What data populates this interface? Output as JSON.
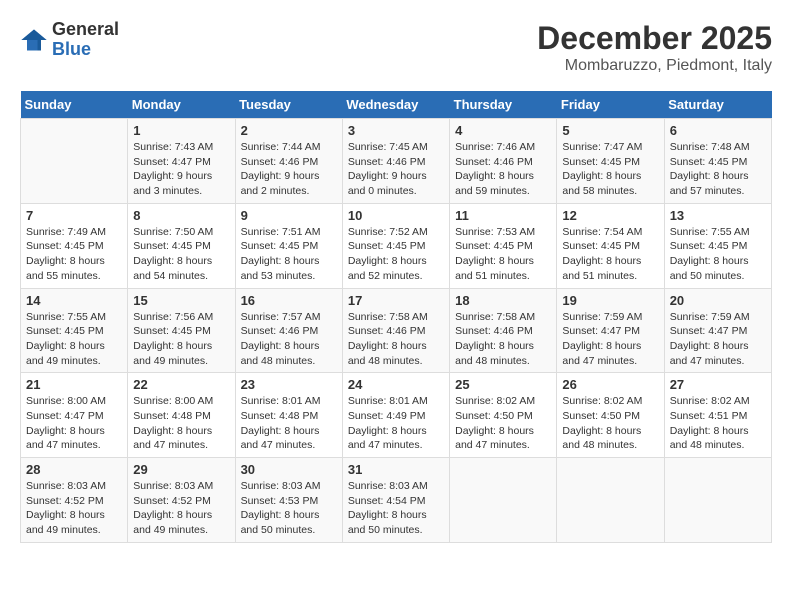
{
  "header": {
    "logo_line1": "General",
    "logo_line2": "Blue",
    "month": "December 2025",
    "location": "Mombaruzzo, Piedmont, Italy"
  },
  "days_of_week": [
    "Sunday",
    "Monday",
    "Tuesday",
    "Wednesday",
    "Thursday",
    "Friday",
    "Saturday"
  ],
  "weeks": [
    [
      {
        "day": "",
        "info": ""
      },
      {
        "day": "1",
        "info": "Sunrise: 7:43 AM\nSunset: 4:47 PM\nDaylight: 9 hours\nand 3 minutes."
      },
      {
        "day": "2",
        "info": "Sunrise: 7:44 AM\nSunset: 4:46 PM\nDaylight: 9 hours\nand 2 minutes."
      },
      {
        "day": "3",
        "info": "Sunrise: 7:45 AM\nSunset: 4:46 PM\nDaylight: 9 hours\nand 0 minutes."
      },
      {
        "day": "4",
        "info": "Sunrise: 7:46 AM\nSunset: 4:46 PM\nDaylight: 8 hours\nand 59 minutes."
      },
      {
        "day": "5",
        "info": "Sunrise: 7:47 AM\nSunset: 4:45 PM\nDaylight: 8 hours\nand 58 minutes."
      },
      {
        "day": "6",
        "info": "Sunrise: 7:48 AM\nSunset: 4:45 PM\nDaylight: 8 hours\nand 57 minutes."
      }
    ],
    [
      {
        "day": "7",
        "info": "Sunrise: 7:49 AM\nSunset: 4:45 PM\nDaylight: 8 hours\nand 55 minutes."
      },
      {
        "day": "8",
        "info": "Sunrise: 7:50 AM\nSunset: 4:45 PM\nDaylight: 8 hours\nand 54 minutes."
      },
      {
        "day": "9",
        "info": "Sunrise: 7:51 AM\nSunset: 4:45 PM\nDaylight: 8 hours\nand 53 minutes."
      },
      {
        "day": "10",
        "info": "Sunrise: 7:52 AM\nSunset: 4:45 PM\nDaylight: 8 hours\nand 52 minutes."
      },
      {
        "day": "11",
        "info": "Sunrise: 7:53 AM\nSunset: 4:45 PM\nDaylight: 8 hours\nand 51 minutes."
      },
      {
        "day": "12",
        "info": "Sunrise: 7:54 AM\nSunset: 4:45 PM\nDaylight: 8 hours\nand 51 minutes."
      },
      {
        "day": "13",
        "info": "Sunrise: 7:55 AM\nSunset: 4:45 PM\nDaylight: 8 hours\nand 50 minutes."
      }
    ],
    [
      {
        "day": "14",
        "info": "Sunrise: 7:55 AM\nSunset: 4:45 PM\nDaylight: 8 hours\nand 49 minutes."
      },
      {
        "day": "15",
        "info": "Sunrise: 7:56 AM\nSunset: 4:45 PM\nDaylight: 8 hours\nand 49 minutes."
      },
      {
        "day": "16",
        "info": "Sunrise: 7:57 AM\nSunset: 4:46 PM\nDaylight: 8 hours\nand 48 minutes."
      },
      {
        "day": "17",
        "info": "Sunrise: 7:58 AM\nSunset: 4:46 PM\nDaylight: 8 hours\nand 48 minutes."
      },
      {
        "day": "18",
        "info": "Sunrise: 7:58 AM\nSunset: 4:46 PM\nDaylight: 8 hours\nand 48 minutes."
      },
      {
        "day": "19",
        "info": "Sunrise: 7:59 AM\nSunset: 4:47 PM\nDaylight: 8 hours\nand 47 minutes."
      },
      {
        "day": "20",
        "info": "Sunrise: 7:59 AM\nSunset: 4:47 PM\nDaylight: 8 hours\nand 47 minutes."
      }
    ],
    [
      {
        "day": "21",
        "info": "Sunrise: 8:00 AM\nSunset: 4:47 PM\nDaylight: 8 hours\nand 47 minutes."
      },
      {
        "day": "22",
        "info": "Sunrise: 8:00 AM\nSunset: 4:48 PM\nDaylight: 8 hours\nand 47 minutes."
      },
      {
        "day": "23",
        "info": "Sunrise: 8:01 AM\nSunset: 4:48 PM\nDaylight: 8 hours\nand 47 minutes."
      },
      {
        "day": "24",
        "info": "Sunrise: 8:01 AM\nSunset: 4:49 PM\nDaylight: 8 hours\nand 47 minutes."
      },
      {
        "day": "25",
        "info": "Sunrise: 8:02 AM\nSunset: 4:50 PM\nDaylight: 8 hours\nand 47 minutes."
      },
      {
        "day": "26",
        "info": "Sunrise: 8:02 AM\nSunset: 4:50 PM\nDaylight: 8 hours\nand 48 minutes."
      },
      {
        "day": "27",
        "info": "Sunrise: 8:02 AM\nSunset: 4:51 PM\nDaylight: 8 hours\nand 48 minutes."
      }
    ],
    [
      {
        "day": "28",
        "info": "Sunrise: 8:03 AM\nSunset: 4:52 PM\nDaylight: 8 hours\nand 49 minutes."
      },
      {
        "day": "29",
        "info": "Sunrise: 8:03 AM\nSunset: 4:52 PM\nDaylight: 8 hours\nand 49 minutes."
      },
      {
        "day": "30",
        "info": "Sunrise: 8:03 AM\nSunset: 4:53 PM\nDaylight: 8 hours\nand 50 minutes."
      },
      {
        "day": "31",
        "info": "Sunrise: 8:03 AM\nSunset: 4:54 PM\nDaylight: 8 hours\nand 50 minutes."
      },
      {
        "day": "",
        "info": ""
      },
      {
        "day": "",
        "info": ""
      },
      {
        "day": "",
        "info": ""
      }
    ]
  ]
}
